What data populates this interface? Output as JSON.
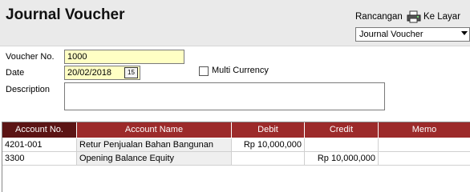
{
  "header": {
    "title": "Journal Voucher",
    "rancangan_label": "Rancangan",
    "kelayar_label": "Ke Layar",
    "template_select": "Journal Voucher"
  },
  "form": {
    "voucher_no_label": "Voucher No.",
    "voucher_no_value": "1000",
    "date_label": "Date",
    "date_value": "20/02/2018",
    "calendar_glyph": "15",
    "multi_currency_label": "Multi Currency",
    "multi_currency_checked": false,
    "description_label": "Description",
    "description_value": ""
  },
  "grid": {
    "columns": [
      "Account No.",
      "Account Name",
      "Debit",
      "Credit",
      "Memo"
    ],
    "selected_column": "Account No.",
    "header_color": "#9c2a2a",
    "rows": [
      {
        "account_no": "4201-001",
        "account_name": "Retur Penjualan Bahan Bangunan",
        "debit": "Rp 10,000,000",
        "credit": "",
        "memo": ""
      },
      {
        "account_no": "3300",
        "account_name": "Opening Balance Equity",
        "debit": "",
        "credit": "Rp 10,000,000",
        "memo": ""
      }
    ]
  }
}
